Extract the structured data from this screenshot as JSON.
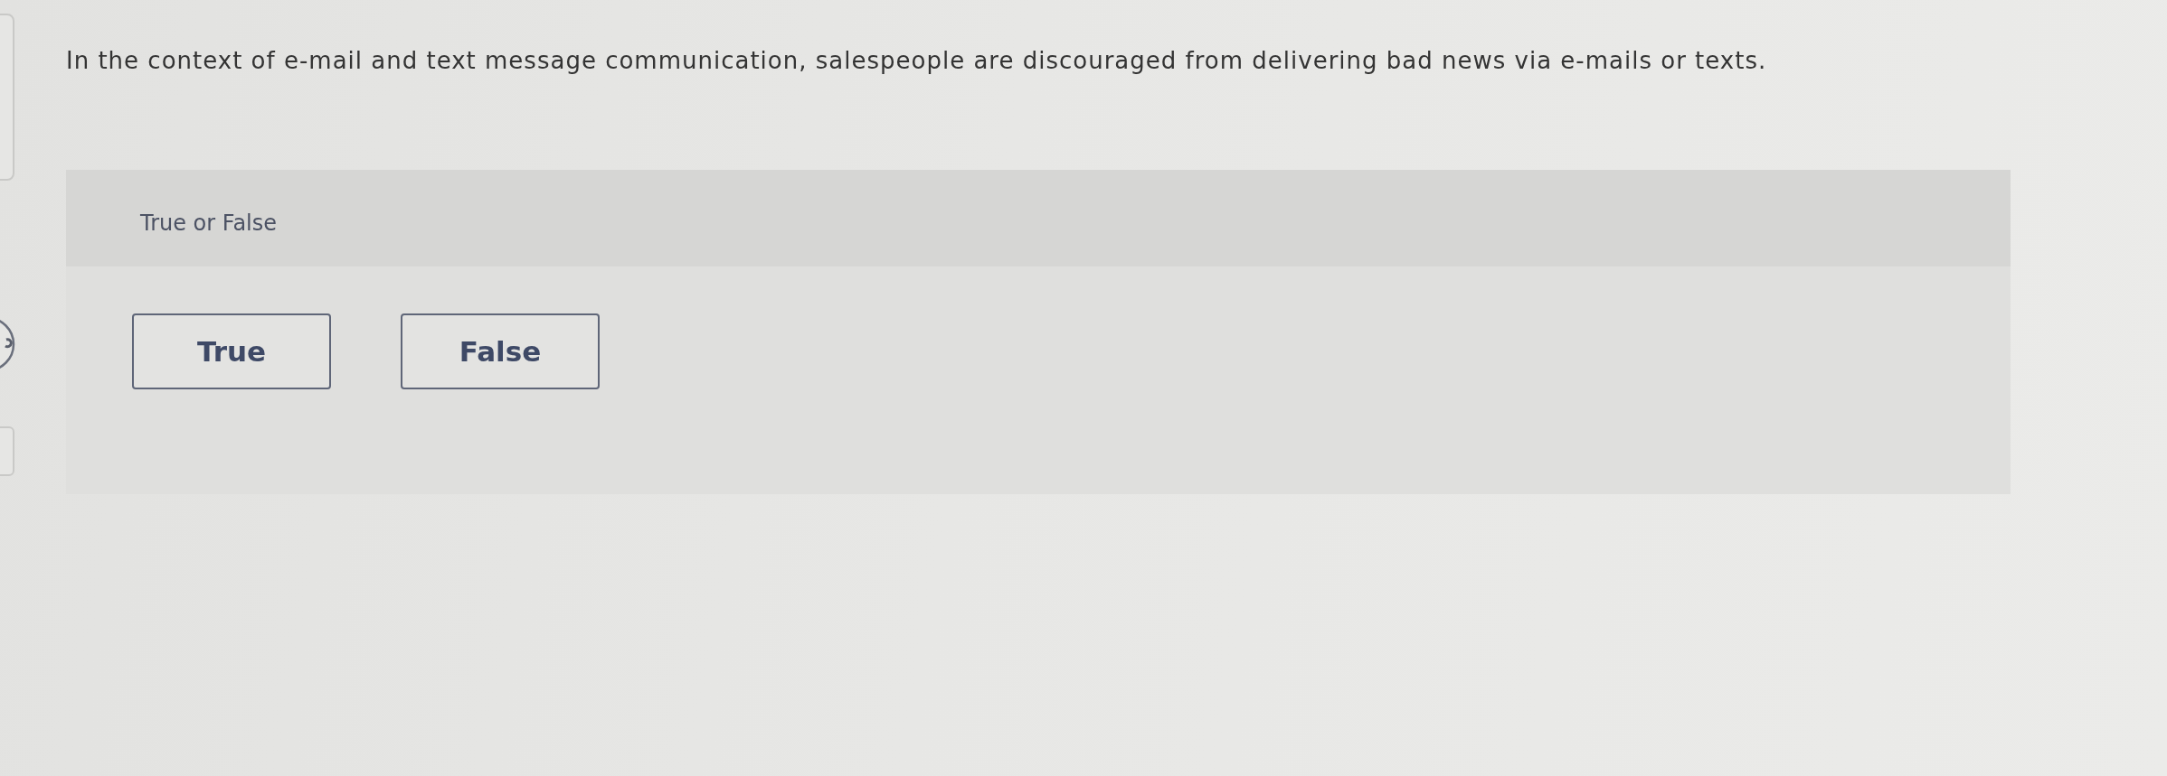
{
  "question": {
    "text": "In the context of e-mail and text message communication, salespeople are discouraged from delivering bad news via e-mails or texts."
  },
  "answer_panel": {
    "label": "True or False",
    "options": [
      {
        "label": "True",
        "selected": false
      },
      {
        "label": "False",
        "selected": false
      }
    ]
  }
}
